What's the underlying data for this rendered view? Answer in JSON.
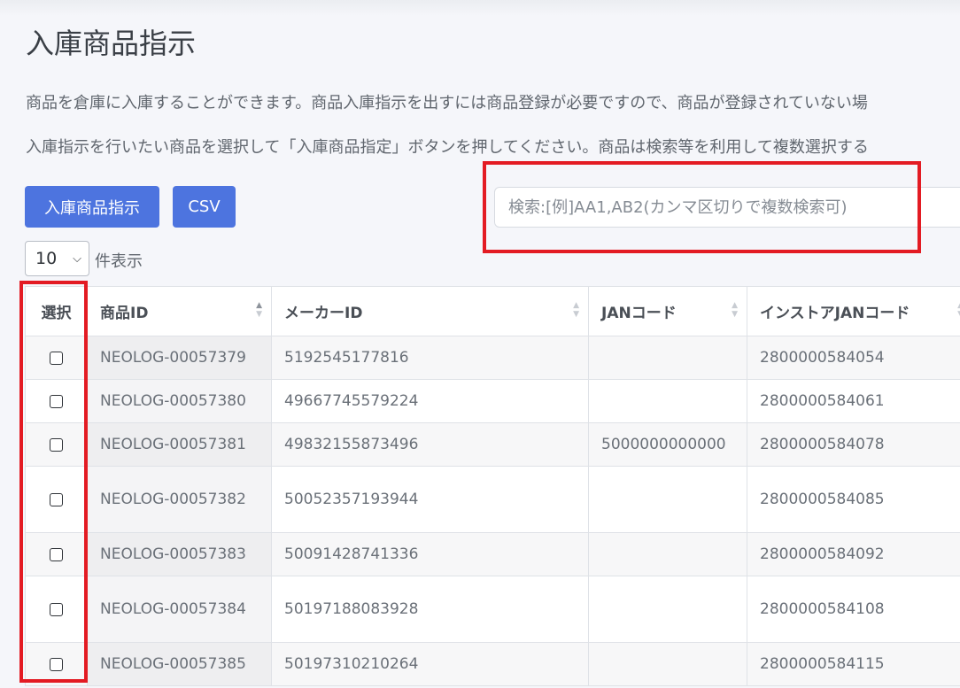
{
  "page": {
    "title": "入庫商品指示",
    "desc1": "商品を倉庫に入庫することができます。商品入庫指示を出すには商品登録が必要ですので、商品が登録されていない場",
    "desc2": "入庫指示を行いたい商品を選択して「入庫商品指定」ボタンを押してください。商品は検索等を利用して複数選択する"
  },
  "toolbar": {
    "primary_label": "入庫商品指示",
    "csv_label": "CSV",
    "search_placeholder": "検索:[例]AA1,AB2(カンマ区切りで複数検索可)"
  },
  "perpage": {
    "value": "10",
    "label": "件表示"
  },
  "table": {
    "headers": [
      "選択",
      "商品ID",
      "メーカーID",
      "JANコード",
      "インストアJANコード"
    ],
    "rows": [
      {
        "id": "NEOLOG-00057379",
        "maker": "5192545177816",
        "jan": "",
        "instore": "2800000584054"
      },
      {
        "id": "NEOLOG-00057380",
        "maker": "49667745579224",
        "jan": "",
        "instore": "2800000584061"
      },
      {
        "id": "NEOLOG-00057381",
        "maker": "49832155873496",
        "jan": "5000000000000",
        "instore": "2800000584078"
      },
      {
        "id": "NEOLOG-00057382",
        "maker": "50052357193944",
        "jan": "",
        "instore": "2800000584085"
      },
      {
        "id": "NEOLOG-00057383",
        "maker": "50091428741336",
        "jan": "",
        "instore": "2800000584092"
      },
      {
        "id": "NEOLOG-00057384",
        "maker": "50197188083928",
        "jan": "",
        "instore": "2800000584108"
      },
      {
        "id": "NEOLOG-00057385",
        "maker": "50197310210264",
        "jan": "",
        "instore": "2800000584115"
      }
    ]
  },
  "colors": {
    "accent": "#4d74df",
    "highlight": "#e31b23"
  }
}
